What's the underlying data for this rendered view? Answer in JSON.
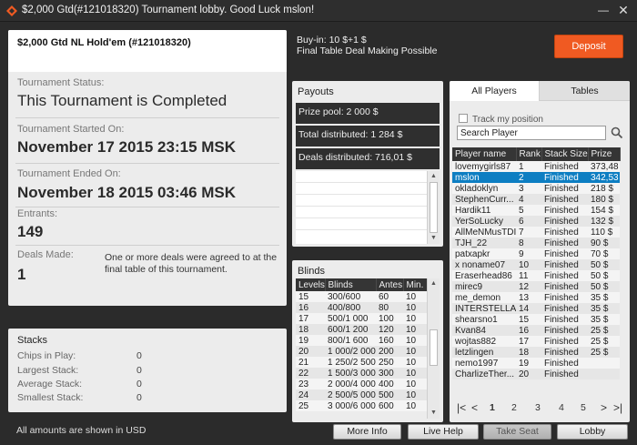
{
  "window": {
    "title": "$2,000 Gtd(#121018320) Tournament lobby. Good Luck mslon!",
    "minimize": "—",
    "close": "✕"
  },
  "tournament": {
    "name": "$2,000 Gtd NL Hold'em (#121018320)",
    "status_label": "Tournament Status:",
    "status_value": "This Tournament is Completed",
    "started_label": "Tournament Started On:",
    "started_value": "November 17 2015   23:15 MSK",
    "ended_label": "Tournament Ended On:",
    "ended_value": "November 18 2015   03:46 MSK",
    "entrants_label": "Entrants:",
    "entrants_value": "149",
    "deals_label": "Deals Made:",
    "deals_value": "1",
    "deals_note": "One or more deals were agreed to at the final table of this tournament."
  },
  "stacks": {
    "title": "Stacks",
    "rows": [
      {
        "label": "Chips in Play:",
        "value": "0"
      },
      {
        "label": "Largest Stack:",
        "value": "0"
      },
      {
        "label": "Average Stack:",
        "value": "0"
      },
      {
        "label": "Smallest Stack:",
        "value": "0"
      }
    ]
  },
  "footnote": "All amounts are shown in USD",
  "header": {
    "buyin": "Buy-in: 10 $+1 $",
    "final_deal": "Final Table Deal Making Possible",
    "deposit_label": "Deposit"
  },
  "payouts": {
    "title": "Payouts",
    "prize_pool": "Prize pool: 2 000 $",
    "total_distributed": "Total distributed: 1 284 $",
    "deals_distributed": "Deals distributed: 716,01 $"
  },
  "blinds": {
    "title": "Blinds",
    "columns": [
      "Levels",
      "Blinds",
      "Antes",
      "Min."
    ],
    "rows": [
      [
        "15",
        "300/600",
        "60",
        "10"
      ],
      [
        "16",
        "400/800",
        "80",
        "10"
      ],
      [
        "17",
        "500/1 000",
        "100",
        "10"
      ],
      [
        "18",
        "600/1 200",
        "120",
        "10"
      ],
      [
        "19",
        "800/1 600",
        "160",
        "10"
      ],
      [
        "20",
        "1 000/2 000",
        "200",
        "10"
      ],
      [
        "21",
        "1 250/2 500",
        "250",
        "10"
      ],
      [
        "22",
        "1 500/3 000",
        "300",
        "10"
      ],
      [
        "23",
        "2 000/4 000",
        "400",
        "10"
      ],
      [
        "24",
        "2 500/5 000",
        "500",
        "10"
      ],
      [
        "25",
        "3 000/6 000",
        "600",
        "10"
      ]
    ]
  },
  "players": {
    "tab_all": "All Players",
    "tab_tables": "Tables",
    "track_label": "Track my position",
    "search_placeholder": "Search Player",
    "columns": [
      "Player name",
      "Rank",
      "Stack Size",
      "Prize"
    ],
    "rows": [
      [
        "lovemygirls87",
        "1",
        "Finished",
        "373,48 $"
      ],
      [
        "mslon",
        "2",
        "Finished",
        "342,53 $"
      ],
      [
        "okladoklyn",
        "3",
        "Finished",
        "218 $"
      ],
      [
        "StephenCurr...",
        "4",
        "Finished",
        "180 $"
      ],
      [
        "Hardik11",
        "5",
        "Finished",
        "154 $"
      ],
      [
        "YerSoLucky",
        "6",
        "Finished",
        "132 $"
      ],
      [
        "AllMeNMusTDIE1",
        "7",
        "Finished",
        "110 $"
      ],
      [
        "TJH_22",
        "8",
        "Finished",
        "90 $"
      ],
      [
        "patxapkr",
        "9",
        "Finished",
        "70 $"
      ],
      [
        "x noname07",
        "10",
        "Finished",
        "50 $"
      ],
      [
        "Eraserhead86",
        "11",
        "Finished",
        "50 $"
      ],
      [
        "mirec9",
        "12",
        "Finished",
        "50 $"
      ],
      [
        "me_demon",
        "13",
        "Finished",
        "35 $"
      ],
      [
        "INTERSTELLAR_",
        "14",
        "Finished",
        "35 $"
      ],
      [
        "shearsno1",
        "15",
        "Finished",
        "35 $"
      ],
      [
        "Kvan84",
        "16",
        "Finished",
        "25 $"
      ],
      [
        "wojtas882",
        "17",
        "Finished",
        "25 $"
      ],
      [
        "letzlingen",
        "18",
        "Finished",
        "25 $"
      ],
      [
        "nemo1997",
        "19",
        "Finished",
        ""
      ],
      [
        "CharlizeTher...",
        "20",
        "Finished",
        ""
      ]
    ],
    "selected_index": 1,
    "pages": [
      "1",
      "2",
      "3",
      "4",
      "5"
    ]
  },
  "buttons": {
    "more_info": "More Info",
    "live_help": "Live Help",
    "take_seat": "Take Seat",
    "lobby": "Lobby"
  },
  "colors": {
    "accent": "#f05a22",
    "selected_row": "#0d7ec2",
    "background": "#2b2b2b"
  }
}
